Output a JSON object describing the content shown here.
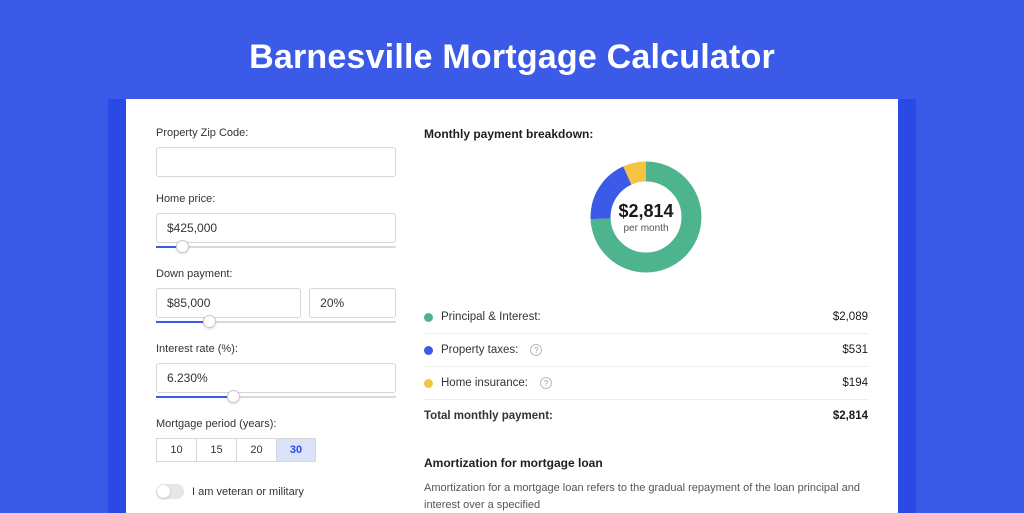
{
  "title": "Barnesville Mortgage Calculator",
  "left": {
    "zip_label": "Property Zip Code:",
    "zip_value": "",
    "home_price_label": "Home price:",
    "home_price_value": "$425,000",
    "home_price_slider_pct": 11,
    "down_label": "Down payment:",
    "down_value": "$85,000",
    "down_pct": "20%",
    "down_slider_pct": 22,
    "rate_label": "Interest rate (%):",
    "rate_value": "6.230%",
    "rate_slider_pct": 32,
    "period_label": "Mortgage period (years):",
    "periods": [
      "10",
      "15",
      "20",
      "30"
    ],
    "period_selected": "30",
    "vet_label": "I am veteran or military"
  },
  "right": {
    "breakdown_title": "Monthly payment breakdown:",
    "center_amount": "$2,814",
    "center_sub": "per month",
    "rows": [
      {
        "color": "green",
        "label": "Principal & Interest:",
        "help": false,
        "amount": "$2,089"
      },
      {
        "color": "blue",
        "label": "Property taxes:",
        "help": true,
        "amount": "$531"
      },
      {
        "color": "yellow",
        "label": "Home insurance:",
        "help": true,
        "amount": "$194"
      }
    ],
    "total_label": "Total monthly payment:",
    "total_amount": "$2,814",
    "amort_title": "Amortization for mortgage loan",
    "amort_text": "Amortization for a mortgage loan refers to the gradual repayment of the loan principal and interest over a specified"
  },
  "chart_data": {
    "type": "pie",
    "title": "Monthly payment breakdown",
    "series": [
      {
        "name": "Principal & Interest",
        "value": 2089,
        "color": "#4db48e"
      },
      {
        "name": "Property taxes",
        "value": 531,
        "color": "#3c5ae8"
      },
      {
        "name": "Home insurance",
        "value": 194,
        "color": "#f4c542"
      }
    ],
    "total": 2814,
    "center_label": "$2,814 per month"
  }
}
